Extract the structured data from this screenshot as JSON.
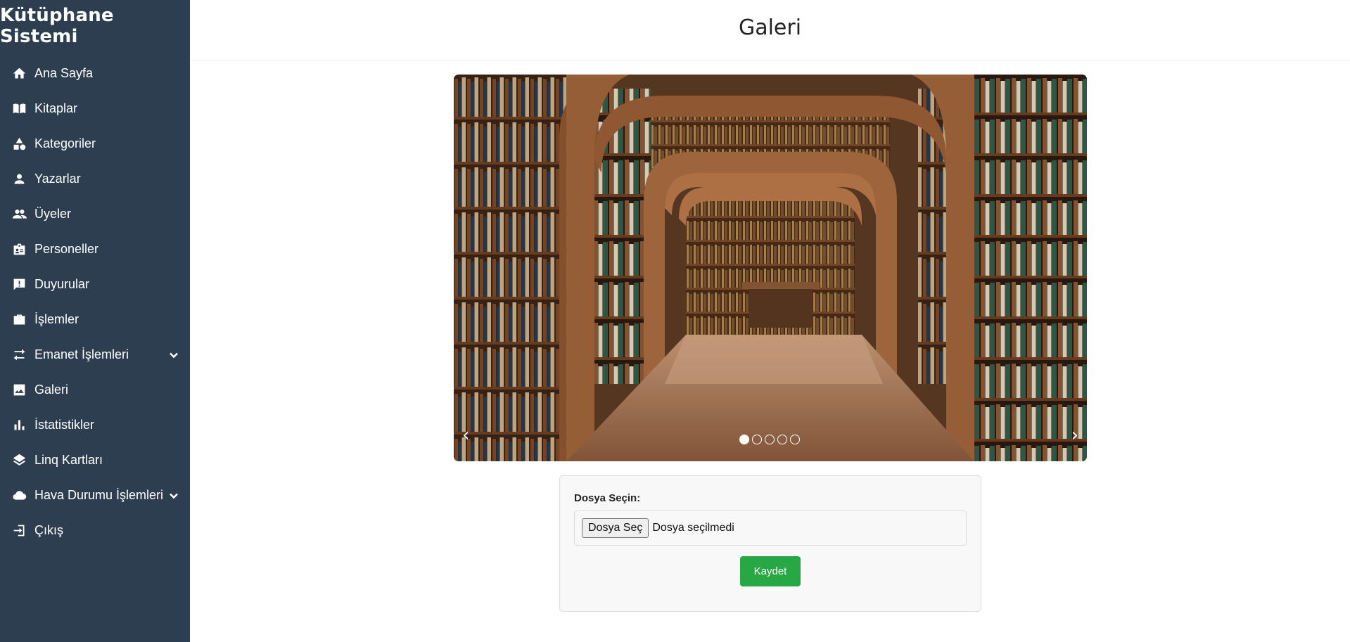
{
  "app": {
    "title": "Kütüphane Sistemi"
  },
  "sidebar": {
    "items": [
      {
        "label": "Ana Sayfa",
        "icon": "home-icon"
      },
      {
        "label": "Kitaplar",
        "icon": "book-icon"
      },
      {
        "label": "Kategoriler",
        "icon": "shapes-icon"
      },
      {
        "label": "Yazarlar",
        "icon": "person-icon"
      },
      {
        "label": "Üyeler",
        "icon": "people-icon"
      },
      {
        "label": "Personeller",
        "icon": "badge-icon"
      },
      {
        "label": "Duyurular",
        "icon": "announcement-icon"
      },
      {
        "label": "İşlemler",
        "icon": "briefcase-icon"
      },
      {
        "label": "Emanet İşlemleri",
        "icon": "swap-icon",
        "has_submenu": true
      },
      {
        "label": "Galeri",
        "icon": "image-icon"
      },
      {
        "label": "İstatistikler",
        "icon": "bar-chart-icon"
      },
      {
        "label": "Linq Kartları",
        "icon": "layers-icon"
      },
      {
        "label": "Hava Durumu İşlemleri",
        "icon": "cloud-icon",
        "has_submenu": true
      },
      {
        "label": "Çıkış",
        "icon": "logout-icon"
      }
    ]
  },
  "page": {
    "title": "Galeri"
  },
  "carousel": {
    "prev_label": "‹",
    "next_label": "›",
    "slide_count": 5,
    "active_index": 0,
    "image_alt": "library-interior-photo"
  },
  "upload": {
    "label": "Dosya Seçin:",
    "file_button": "Dosya Seç",
    "file_status": "Dosya seçilmedi",
    "save_button": "Kaydet"
  },
  "colors": {
    "sidebar": "#2c3e50",
    "save": "#28a745"
  }
}
